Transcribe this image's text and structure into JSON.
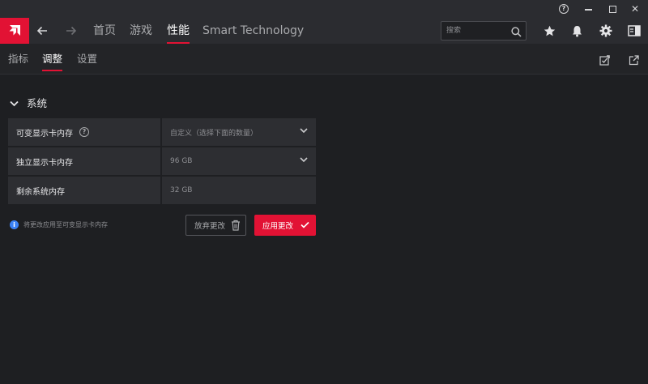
{
  "window": {
    "controls": {
      "help_icon": "help-icon",
      "minimize_icon": "minimize-icon",
      "maximize_icon": "maximize-icon",
      "close_glyph": "✕"
    }
  },
  "nav": {
    "tabs": [
      {
        "label": "首页",
        "active": false
      },
      {
        "label": "游戏",
        "active": false
      },
      {
        "label": "性能",
        "active": true
      },
      {
        "label": "Smart Technology",
        "active": false
      }
    ],
    "search_placeholder": "搜索"
  },
  "subnav": {
    "tabs": [
      {
        "label": "指标",
        "active": false
      },
      {
        "label": "调整",
        "active": true
      },
      {
        "label": "设置",
        "active": false
      }
    ]
  },
  "section": {
    "title": "系统",
    "rows": [
      {
        "label": "可变显示卡内存",
        "value": "自定义（选择下面的数量）",
        "has_help": true,
        "has_dropdown": true
      },
      {
        "label": "独立显示卡内存",
        "value": "96 GB",
        "has_help": false,
        "has_dropdown": true
      },
      {
        "label": "剩余系统内存",
        "value": "32 GB",
        "has_help": false,
        "has_dropdown": false
      }
    ],
    "help_glyph": "?"
  },
  "note": {
    "icon_glyph": "i",
    "text": "将更改应用至可变显示卡内存"
  },
  "buttons": {
    "discard_label": "放弃更改",
    "apply_label": "应用更改"
  },
  "colors": {
    "accent": "#e21234",
    "background": "#1e1f22",
    "header": "#2b2c30",
    "row": "#2d2e32",
    "info": "#3b82f6"
  }
}
